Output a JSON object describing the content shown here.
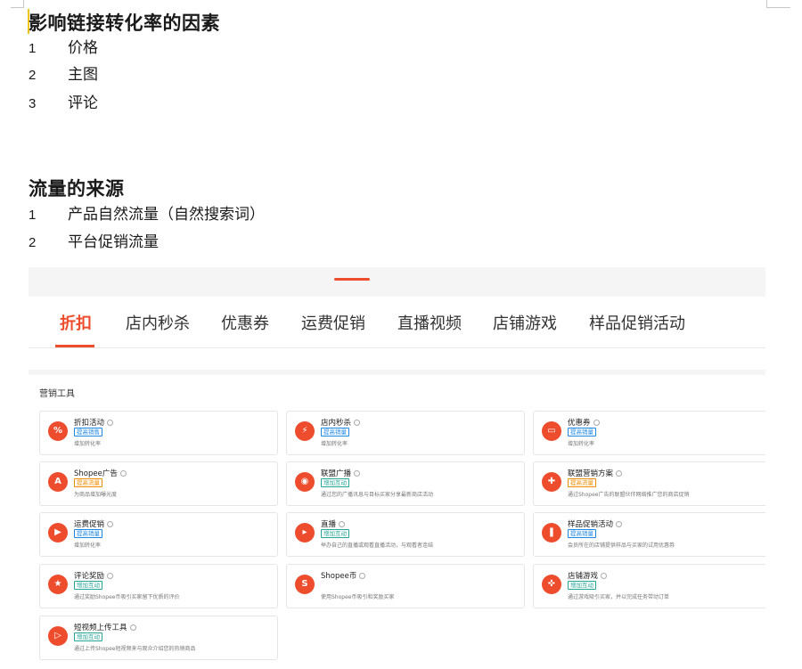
{
  "doc": {
    "heading1": "影响链接转化率的因素",
    "list1": [
      {
        "num": "1",
        "text": "价格"
      },
      {
        "num": "2",
        "text": "主图"
      },
      {
        "num": "3",
        "text": "评论"
      }
    ],
    "heading2": "流量的来源",
    "list2": [
      {
        "num": "1",
        "text": "产品自然流量（自然搜索词）"
      },
      {
        "num": "2",
        "text": "平台促销流量"
      }
    ]
  },
  "embed": {
    "accent_color": "#ee4d2d",
    "tabs": [
      "折扣",
      "店内秒杀",
      "优惠券",
      "运费促销",
      "直播视频",
      "店铺游戏",
      "样品促销活动"
    ],
    "active_tab": "折扣",
    "section_title": "营销工具",
    "tools": [
      {
        "name": "折扣活动",
        "tag": "提高销售",
        "desc": "增加转化率",
        "icon": "discount-tag-icon",
        "tag_color": "#1e88e5"
      },
      {
        "name": "店内秒杀",
        "tag": "提高销量",
        "desc": "增加转化率",
        "icon": "flash-sale-icon",
        "tag_color": "#1e88e5"
      },
      {
        "name": "优惠券",
        "tag": "提高销量",
        "desc": "增加转化率",
        "icon": "coupon-icon",
        "tag_color": "#1e88e5"
      },
      {
        "name": "Shopee广告",
        "tag": "提高流量",
        "desc": "为商品增加曝光度",
        "icon": "ads-icon",
        "tag_color": "#f08c00"
      },
      {
        "name": "联盟广播",
        "tag": "增加互动",
        "desc": "通过您的广播讯息与目标买家分享最新商店活动",
        "icon": "broadcast-icon",
        "tag_color": "#26a69a"
      },
      {
        "name": "联盟营销方案",
        "tag": "提高流量",
        "desc": "通过Shopee广告的联盟伙伴网络推广您的商店促销",
        "icon": "affiliate-icon",
        "tag_color": "#f08c00"
      },
      {
        "name": "运费促销",
        "tag": "提高销量",
        "desc": "增加转化率",
        "icon": "shipping-truck-icon",
        "tag_color": "#1e88e5"
      },
      {
        "name": "直播",
        "tag": "增加互动",
        "desc": "举办自己的直播或观看直播活动，与观看者连结",
        "icon": "live-stream-icon",
        "tag_color": "#26a69a"
      },
      {
        "name": "样品促销活动",
        "tag": "提高销量",
        "desc": "会员所在的店铺提供样品与买家的试用优惠券",
        "icon": "sample-icon",
        "tag_color": "#1e88e5"
      },
      {
        "name": "评论奖励",
        "tag": "增加互动",
        "desc": "通过奖励Shopee币吸引买家留下优质的评价",
        "icon": "review-reward-icon",
        "tag_color": "#26a69a"
      },
      {
        "name": "Shopee币",
        "tag": "",
        "desc": "使用Shopee币吸引和奖励买家",
        "icon": "coin-icon",
        "tag_color": "#26a69a"
      },
      {
        "name": "店铺游戏",
        "tag": "增加互动",
        "desc": "通过游戏吸引买家，并以完成任务带动订单",
        "icon": "game-controller-icon",
        "tag_color": "#26a69a"
      },
      {
        "name": "短视频上传工具",
        "tag": "增加互动",
        "desc": "通过上传Shopee短视频来与观众介绍您的热销商品",
        "icon": "video-play-icon",
        "tag_color": "#26a69a"
      }
    ]
  }
}
